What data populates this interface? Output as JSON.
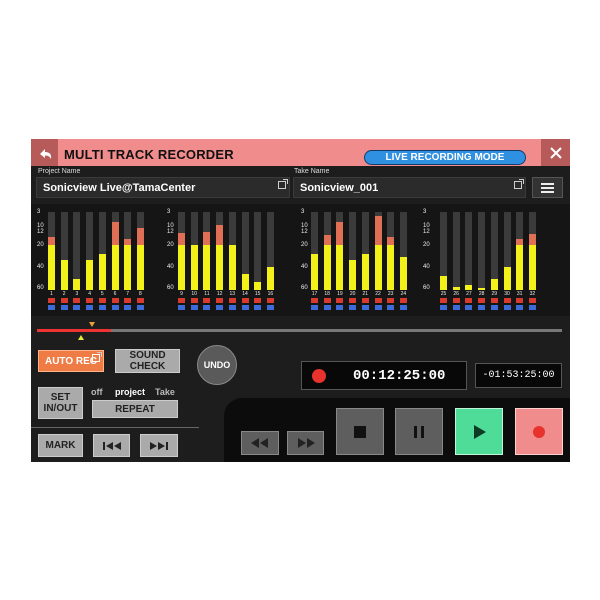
{
  "header": {
    "title": "MULTI TRACK RECORDER",
    "mode_badge": "LIVE RECORDING MODE"
  },
  "project": {
    "label": "Project Name",
    "value": "Sonicview Live@TamaCenter"
  },
  "take": {
    "label": "Take Name",
    "value": "Sonicview_001"
  },
  "meter_scale": [
    "3",
    "10",
    "12",
    "20",
    "40",
    "60"
  ],
  "channels": [
    {
      "num": "1",
      "level": 0.58,
      "peak": 0.68
    },
    {
      "num": "2",
      "level": 0.39,
      "peak": 0.39
    },
    {
      "num": "3",
      "level": 0.14,
      "peak": 0.14
    },
    {
      "num": "4",
      "level": 0.38,
      "peak": 0.38
    },
    {
      "num": "5",
      "level": 0.46,
      "peak": 0.46
    },
    {
      "num": "6",
      "level": 0.58,
      "peak": 0.87
    },
    {
      "num": "7",
      "level": 0.58,
      "peak": 0.66
    },
    {
      "num": "8",
      "level": 0.58,
      "peak": 0.8
    },
    {
      "num": "9",
      "level": 0.58,
      "peak": 0.73
    },
    {
      "num": "10",
      "level": 0.58,
      "peak": 0.58
    },
    {
      "num": "11",
      "level": 0.58,
      "peak": 0.74
    },
    {
      "num": "12",
      "level": 0.58,
      "peak": 0.83
    },
    {
      "num": "13",
      "level": 0.58,
      "peak": 0.58
    },
    {
      "num": "14",
      "level": 0.2,
      "peak": 0.2
    },
    {
      "num": "15",
      "level": 0.1,
      "peak": 0.1
    },
    {
      "num": "16",
      "level": 0.3,
      "peak": 0.3
    },
    {
      "num": "17",
      "level": 0.46,
      "peak": 0.46
    },
    {
      "num": "18",
      "level": 0.58,
      "peak": 0.7
    },
    {
      "num": "19",
      "level": 0.58,
      "peak": 0.87
    },
    {
      "num": "20",
      "level": 0.38,
      "peak": 0.38
    },
    {
      "num": "21",
      "level": 0.46,
      "peak": 0.46
    },
    {
      "num": "22",
      "level": 0.58,
      "peak": 0.95
    },
    {
      "num": "23",
      "level": 0.58,
      "peak": 0.68
    },
    {
      "num": "24",
      "level": 0.42,
      "peak": 0.42
    },
    {
      "num": "25",
      "level": 0.18,
      "peak": 0.18
    },
    {
      "num": "26",
      "level": 0.04,
      "peak": 0.04
    },
    {
      "num": "27",
      "level": 0.06,
      "peak": 0.06
    },
    {
      "num": "28",
      "level": 0.03,
      "peak": 0.03
    },
    {
      "num": "29",
      "level": 0.14,
      "peak": 0.14
    },
    {
      "num": "30",
      "level": 0.3,
      "peak": 0.3
    },
    {
      "num": "31",
      "level": 0.58,
      "peak": 0.66
    },
    {
      "num": "32",
      "level": 0.58,
      "peak": 0.72
    }
  ],
  "controls": {
    "auto_rec": "AUTO REC",
    "sound_check_l1": "SOUND",
    "sound_check_l2": "CHECK",
    "undo": "UNDO",
    "set_in_out_l1": "SET",
    "set_in_out_l2": "IN/OUT",
    "repeat_off": "off",
    "repeat_project": "project",
    "repeat_take": "Take",
    "repeat": "REPEAT",
    "mark": "MARK"
  },
  "counter": {
    "elapsed": "00:12:25:00",
    "remaining": "-01:53:25:00"
  },
  "playback_progress": 0.14,
  "colors": {
    "accent": "#f08c8c",
    "rec": "#e8322e",
    "play": "#4fdb98",
    "meter": "#f2f21a",
    "peak": "#e07055",
    "badge": "#2f8fe0"
  }
}
